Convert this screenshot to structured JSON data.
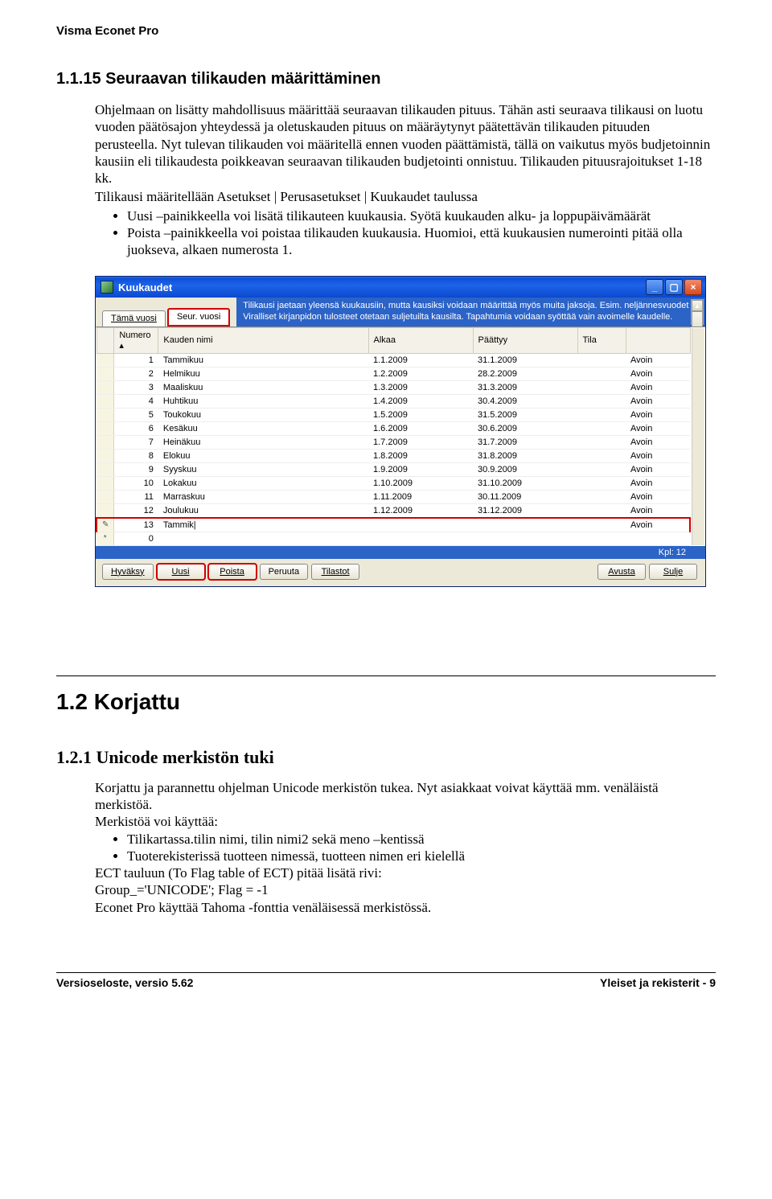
{
  "doc": {
    "header": "Visma Econet Pro",
    "section115_title": "1.1.15 Seuraavan tilikauden määrittäminen",
    "para1": "Ohjelmaan on lisätty mahdollisuus määrittää seuraavan tilikauden pituus. Tähän asti seuraava tilikausi on luotu vuoden päätösajon yhteydessä ja oletuskauden pituus on määräytynyt päätettävän tilikauden pituuden perusteella. Nyt tulevan tilikauden voi määritellä ennen vuoden päättämistä, tällä on vaikutus myös budjetoinnin kausiin eli tilikaudesta poikkeavan seuraavan tilikauden budjetointi onnistuu. Tilikauden pituusrajoitukset 1-18 kk.",
    "para2": "Tilikausi määritellään Asetukset | Perusasetukset | Kuukaudet taulussa",
    "bullets1": [
      "Uusi –painikkeella voi lisätä tilikauteen kuukausia. Syötä kuukauden alku- ja loppupäivämäärät",
      "Poista –painikkeella voi poistaa tilikauden kuukausia. Huomioi, että kuukausien numerointi pitää olla juokseva, alkaen numerosta 1."
    ],
    "section12_title": "1.2 Korjattu",
    "section121_title": "1.2.1  Unicode merkistön tuki",
    "para3a": "Korjattu ja parannettu ohjelman Unicode merkistön tukea. Nyt asiakkaat voivat käyttää mm. venäläistä merkistöä.",
    "para3b": "Merkistöä voi käyttää:",
    "bullets2": [
      "Tilikartassa.tilin nimi, tilin nimi2 sekä meno –kentissä",
      "Tuoterekisterissä tuotteen nimessä, tuotteen nimen eri kielellä"
    ],
    "para4a": "ECT tauluun (To Flag table of ECT) pitää lisätä rivi:",
    "para4b": "Group_='UNICODE'; Flag = -1",
    "para4c": "Econet Pro käyttää Tahoma -fonttia venäläisessä merkistössä.",
    "footer_left": "Versioseloste, versio 5.62",
    "footer_right": "Yleiset ja rekisterit - 9"
  },
  "app": {
    "title": "Kuukaudet",
    "tabs": {
      "this_year": "Tämä vuosi",
      "next_year": "Seur. vuosi"
    },
    "info": "Tilikausi jaetaan yleensä kuukausiin, mutta kausiksi voidaan määrittää myös muita jaksoja. Esim. neljännesvuodet Viralliset kirjanpidon tulosteet otetaan suljetuilta kausilta. Tapahtumia voidaan syöttää vain avoimelle kaudelle.",
    "columns": {
      "numero": "Numero",
      "nimi": "Kauden nimi",
      "alkaa": "Alkaa",
      "paattyy": "Päättyy",
      "tila": "Tila"
    },
    "rows": [
      {
        "n": "1",
        "name": "Tammikuu",
        "start": "1.1.2009",
        "end": "31.1.2009",
        "state": "Avoin"
      },
      {
        "n": "2",
        "name": "Helmikuu",
        "start": "1.2.2009",
        "end": "28.2.2009",
        "state": "Avoin"
      },
      {
        "n": "3",
        "name": "Maaliskuu",
        "start": "1.3.2009",
        "end": "31.3.2009",
        "state": "Avoin"
      },
      {
        "n": "4",
        "name": "Huhtikuu",
        "start": "1.4.2009",
        "end": "30.4.2009",
        "state": "Avoin"
      },
      {
        "n": "5",
        "name": "Toukokuu",
        "start": "1.5.2009",
        "end": "31.5.2009",
        "state": "Avoin"
      },
      {
        "n": "6",
        "name": "Kesäkuu",
        "start": "1.6.2009",
        "end": "30.6.2009",
        "state": "Avoin"
      },
      {
        "n": "7",
        "name": "Heinäkuu",
        "start": "1.7.2009",
        "end": "31.7.2009",
        "state": "Avoin"
      },
      {
        "n": "8",
        "name": "Elokuu",
        "start": "1.8.2009",
        "end": "31.8.2009",
        "state": "Avoin"
      },
      {
        "n": "9",
        "name": "Syyskuu",
        "start": "1.9.2009",
        "end": "30.9.2009",
        "state": "Avoin"
      },
      {
        "n": "10",
        "name": "Lokakuu",
        "start": "1.10.2009",
        "end": "31.10.2009",
        "state": "Avoin"
      },
      {
        "n": "11",
        "name": "Marraskuu",
        "start": "1.11.2009",
        "end": "30.11.2009",
        "state": "Avoin"
      },
      {
        "n": "12",
        "name": "Joulukuu",
        "start": "1.12.2009",
        "end": "31.12.2009",
        "state": "Avoin"
      }
    ],
    "editing": {
      "icon": "✎",
      "n": "13",
      "name": "Tammik",
      "state": "Avoin"
    },
    "newrow": {
      "icon": "*",
      "n": "0"
    },
    "status": "Kpl: 12",
    "buttons": {
      "hyvaksy": "Hyväksy",
      "uusi": "Uusi",
      "poista": "Poista",
      "peruuta": "Peruuta",
      "tilastot": "Tilastot",
      "avusta": "Avusta",
      "sulje": "Sulje"
    }
  }
}
